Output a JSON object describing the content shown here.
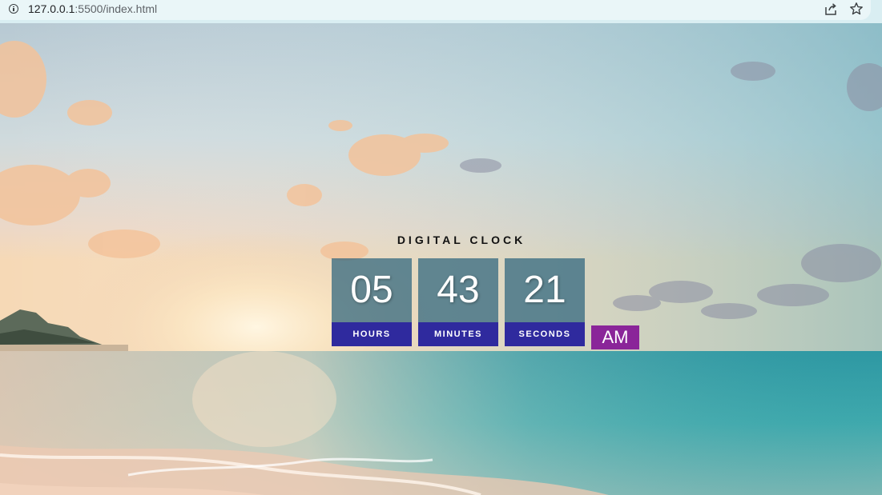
{
  "browser": {
    "url_host": "127.0.0.1",
    "url_rest": ":5500/index.html",
    "icons": [
      "info-icon",
      "share-icon",
      "star-icon"
    ]
  },
  "clock": {
    "title": "DIGITAL CLOCK",
    "hours": {
      "value": "05",
      "label": "HOURS"
    },
    "minutes": {
      "value": "43",
      "label": "MINUTES"
    },
    "seconds": {
      "value": "21",
      "label": "SECONDS"
    },
    "period": "AM"
  },
  "colors": {
    "digit_panel": "#2c647d",
    "label_panel": "#2f2a9e",
    "period_badge": "#8a2599"
  }
}
